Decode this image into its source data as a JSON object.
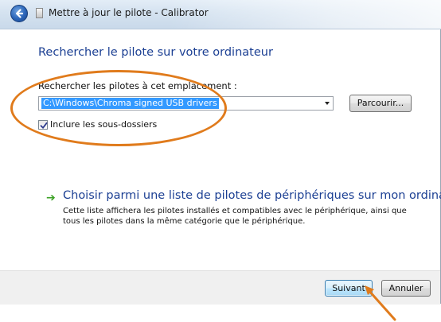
{
  "window": {
    "title": "Mettre à jour le pilote - Calibrator"
  },
  "main": {
    "heading": "Rechercher le pilote sur votre ordinateur",
    "location_label": "Rechercher les pilotes à cet emplacement :",
    "location_value": "C:\\Windows\\Chroma signed USB drivers",
    "browse_label": "Parcourir...",
    "include_subfolders_label": "Inclure les sous-dossiers",
    "include_subfolders_checked": true
  },
  "option": {
    "title": "Choisir parmi une liste de pilotes de périphériques sur mon ordinateur",
    "description": "Cette liste affichera les pilotes installés et compatibles avec le périphérique, ainsi que tous les pilotes dans la même catégorie que le périphérique."
  },
  "footer": {
    "next_label": "Suivant",
    "cancel_label": "Annuler"
  },
  "icons": {
    "back": "back-arrow-icon",
    "title": "driver-document-icon",
    "option": "green-arrow-icon",
    "dropdown": "chevron-down-icon",
    "check": "checkmark-icon"
  },
  "colors": {
    "heading": "#1b3f93",
    "selection": "#3399ff",
    "annotation": "#e07b1c",
    "option_arrow": "#3aa023"
  }
}
